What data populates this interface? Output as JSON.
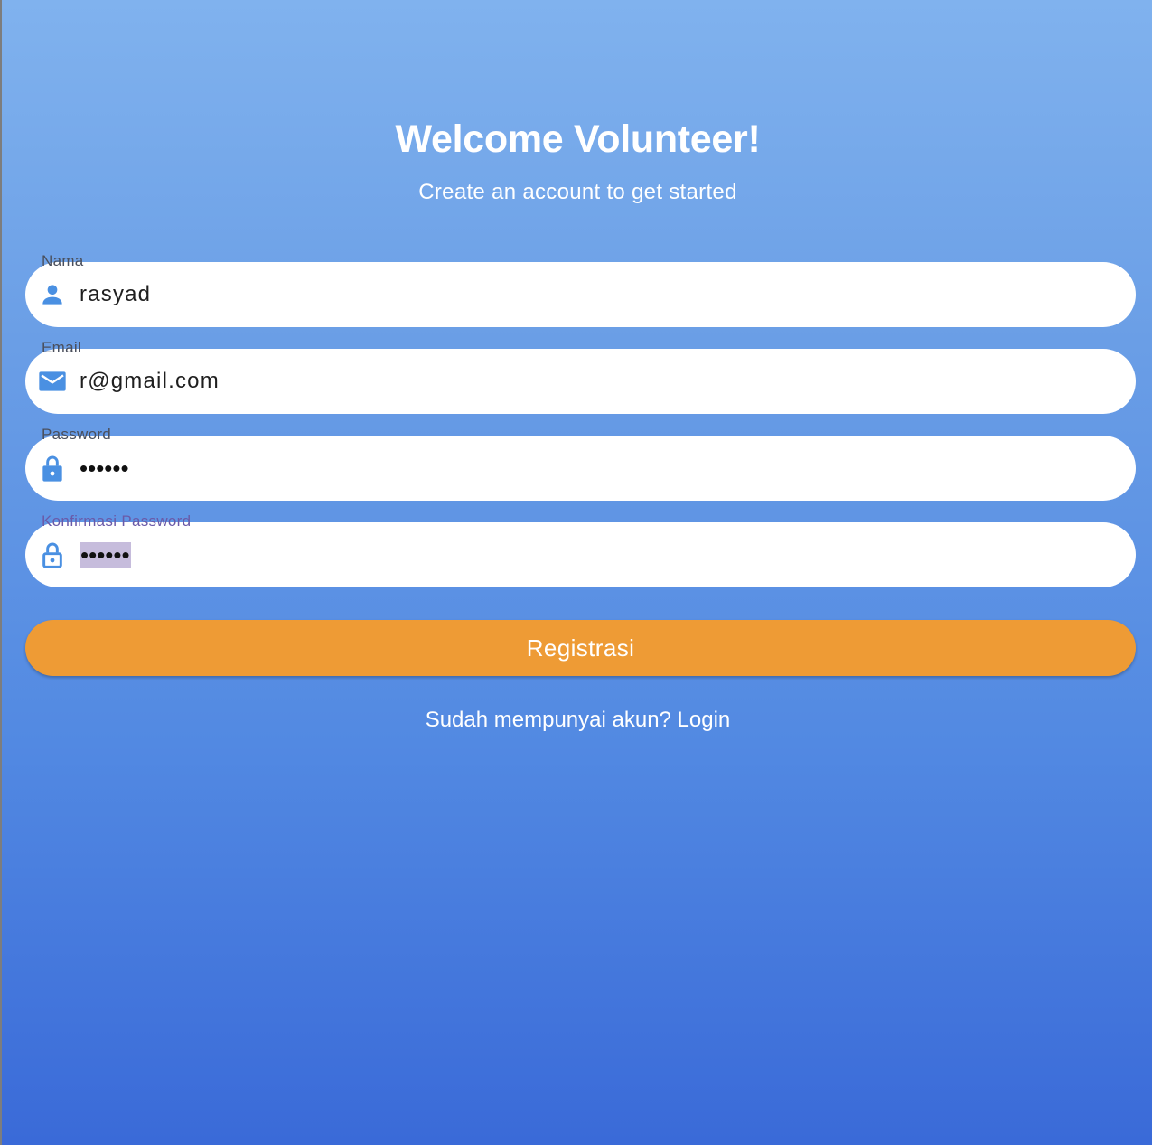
{
  "header": {
    "title": "Welcome Volunteer!",
    "subtitle": "Create an account to get started"
  },
  "form": {
    "name": {
      "label": "Nama",
      "value": "rasyad",
      "icon": "person-icon"
    },
    "email": {
      "label": "Email",
      "value": "r@gmail.com",
      "icon": "mail-icon"
    },
    "password": {
      "label": "Password",
      "value": "••••••",
      "icon": "lock-icon"
    },
    "confirm_password": {
      "label": "Konfirmasi Password",
      "value": "••••••",
      "icon": "lock-outline-icon",
      "focused": true
    }
  },
  "actions": {
    "register_label": "Registrasi",
    "login_prompt": "Sudah mempunyai akun? Login"
  },
  "colors": {
    "accent": "#4a90e2",
    "button": "#ee9b35",
    "focus_label": "#6a5aa8",
    "selection": "#c6bcdc"
  }
}
